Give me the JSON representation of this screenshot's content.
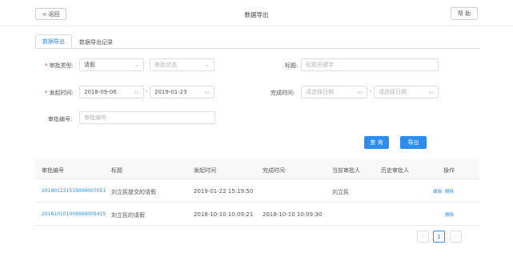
{
  "header": {
    "back_label": "返回",
    "title": "数据导出",
    "help_label": "帮 助"
  },
  "tabs": [
    {
      "label": "数据导出"
    },
    {
      "label": "数据导出记录"
    }
  ],
  "form": {
    "approval_type": {
      "label": "审批类型:",
      "value": "请假",
      "status_placeholder": "审批状态"
    },
    "title": {
      "label": "标题:",
      "placeholder": "标题关键字"
    },
    "start_time": {
      "label": "发起时间:",
      "from": "2018-09-06",
      "to": "2019-01-23",
      "separator": "-"
    },
    "finish_time": {
      "label": "完成时间:",
      "from_placeholder": "请选择日期",
      "to_placeholder": "请选择日期",
      "separator": "-"
    },
    "approval_no": {
      "label": "审批编号:",
      "placeholder": "审批编号"
    },
    "query_label": "查 询",
    "export_label": "导出"
  },
  "table": {
    "columns": [
      "审批编号",
      "标题",
      "发起时间",
      "完成时间",
      "当前审批人",
      "历史审批人",
      "操作"
    ],
    "rows": [
      {
        "no": "201901221519000007051",
        "title": "刘立民提交的请假",
        "start": "2019-01-22 15:19:50",
        "finish": "",
        "current": "刘立民",
        "history": "",
        "ops": [
          "编辑",
          "删除"
        ]
      },
      {
        "no": "201810101009000009415",
        "title": "刘立民的请假",
        "start": "2018-10-10 10:09:21",
        "finish": "2018-10-10 10:09:30",
        "current": "",
        "history": "",
        "ops": [
          "删除"
        ]
      }
    ]
  },
  "pager": {
    "prev": "‹",
    "current": "1",
    "next": "›"
  },
  "colors": {
    "accent": "#2d8cf0",
    "required": "#ed4014"
  }
}
